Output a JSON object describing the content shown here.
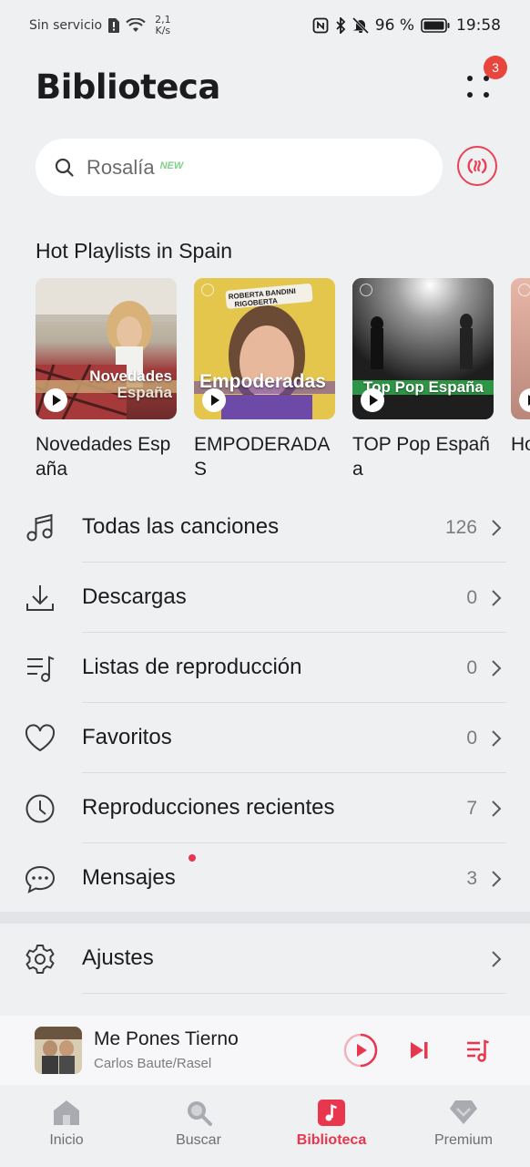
{
  "status_bar": {
    "carrier": "Sin servicio",
    "speed_value": "2,1",
    "speed_unit": "K/s",
    "battery": "96 %",
    "time": "19:58"
  },
  "header": {
    "title": "Biblioteca",
    "badge_count": "3"
  },
  "search": {
    "placeholder": "Rosalía",
    "new_tag": "NEW"
  },
  "hot_playlists": {
    "title": "Hot Playlists in Spain",
    "items": [
      {
        "name": "Novedades España",
        "cover_line1": "Novedades",
        "cover_line2": "España",
        "cover_color": "#c9c0b2"
      },
      {
        "name": "EMPODERADAS",
        "cover_line1": "Empoderadas",
        "cover_color": "#e2c24a",
        "band_top": "ROBERTA BANDINI",
        "band_right": "RIGOBERTA"
      },
      {
        "name": "TOP Pop España",
        "cover_line1": "Top Pop España",
        "cover_color": "#3a3a3a"
      },
      {
        "name": "Ho",
        "cover_color": "#d9a99b"
      }
    ]
  },
  "menu": [
    {
      "label": "Todas las canciones",
      "count": "126",
      "icon": "music-note-icon"
    },
    {
      "label": "Descargas",
      "count": "0",
      "icon": "download-icon"
    },
    {
      "label": "Listas de reproducción",
      "count": "0",
      "icon": "playlist-icon"
    },
    {
      "label": "Favoritos",
      "count": "0",
      "icon": "heart-icon"
    },
    {
      "label": "Reproducciones recientes",
      "count": "7",
      "icon": "clock-icon"
    },
    {
      "label": "Mensajes",
      "count": "3",
      "icon": "message-icon"
    }
  ],
  "settings": {
    "label": "Ajustes",
    "icon": "gear-icon"
  },
  "mini_player": {
    "title": "Me Pones Tierno",
    "artist": "Carlos Baute/Rasel"
  },
  "bottom_nav": [
    {
      "label": "Inicio",
      "icon": "home-icon"
    },
    {
      "label": "Buscar",
      "icon": "search-icon"
    },
    {
      "label": "Biblioteca",
      "icon": "library-icon"
    },
    {
      "label": "Premium",
      "icon": "diamond-icon"
    }
  ],
  "colors": {
    "accent": "#e8364f",
    "badge": "#e8453c",
    "background": "#eff0f2"
  }
}
